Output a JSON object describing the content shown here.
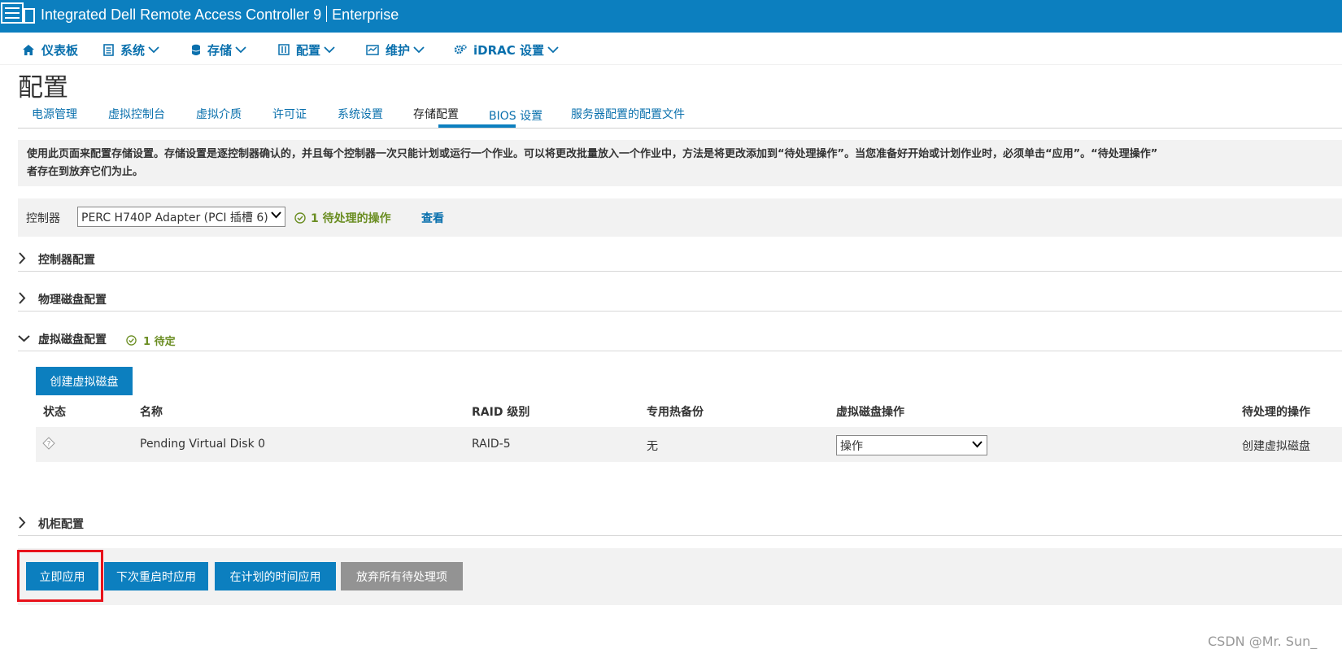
{
  "header": {
    "title": "Integrated Dell Remote Access Controller 9",
    "edition": "Enterprise"
  },
  "nav": {
    "items": [
      {
        "label": "仪表板",
        "icon": "home-icon"
      },
      {
        "label": "系统",
        "icon": "server-icon"
      },
      {
        "label": "存储",
        "icon": "database-icon"
      },
      {
        "label": "配置",
        "icon": "config-grid-icon"
      },
      {
        "label": "维护",
        "icon": "monitor-icon"
      },
      {
        "label": "iDRAC 设置",
        "icon": "gears-icon"
      }
    ]
  },
  "page": {
    "title": "配置"
  },
  "tabs": [
    {
      "label": "电源管理"
    },
    {
      "label": "虚拟控制台"
    },
    {
      "label": "虚拟介质"
    },
    {
      "label": "许可证"
    },
    {
      "label": "系统设置"
    },
    {
      "label": "存储配置",
      "active": true
    },
    {
      "label": "BIOS 设置"
    },
    {
      "label": "服务器配置的配置文件"
    }
  ],
  "info": {
    "line1": "使用此页面来配置存储设置。存储设置是逐控制器确认的，并且每个控制器一次只能计划或运行一个作业。可以将更改批量放入一个作业中，方法是将更改添加到“待处理操作”。当您准备好开始或计划作业时，必须单击“应用”。“待处理操作”",
    "line2": "者存在到放弃它们为止。"
  },
  "controller": {
    "label": "控制器",
    "selected": "PERC H740P Adapter (PCI 插槽 6)",
    "pending_text": "1 待处理的操作",
    "view_link": "查看"
  },
  "sections": {
    "controller_config": "控制器配置",
    "physical_disk_config": "物理磁盘配置",
    "virtual_disk_config": "虚拟磁盘配置",
    "virtual_disk_badge": "1 待定",
    "enclosure_config": "机柜配置"
  },
  "virtual_disk": {
    "create_button": "创建虚拟磁盘",
    "columns": [
      "状态",
      "名称",
      "RAID 级别",
      "专用热备份",
      "虚拟磁盘操作",
      "待处理的操作"
    ],
    "rows": [
      {
        "name": "Pending Virtual Disk 0",
        "raid": "RAID-5",
        "hot_spare": "无",
        "action": "操作",
        "pending": "创建虚拟磁盘"
      }
    ]
  },
  "actions": {
    "apply_now": "立即应用",
    "apply_next_reboot": "下次重启时应用",
    "apply_scheduled": "在计划的时间应用",
    "discard_all": "放弃所有待处理项"
  },
  "watermark": "CSDN @Mr. Sun_",
  "colors": {
    "brand": "#0c7fbf",
    "link": "#0a70ad",
    "pending": "#6b8e23",
    "highlight": "#e8121b"
  }
}
